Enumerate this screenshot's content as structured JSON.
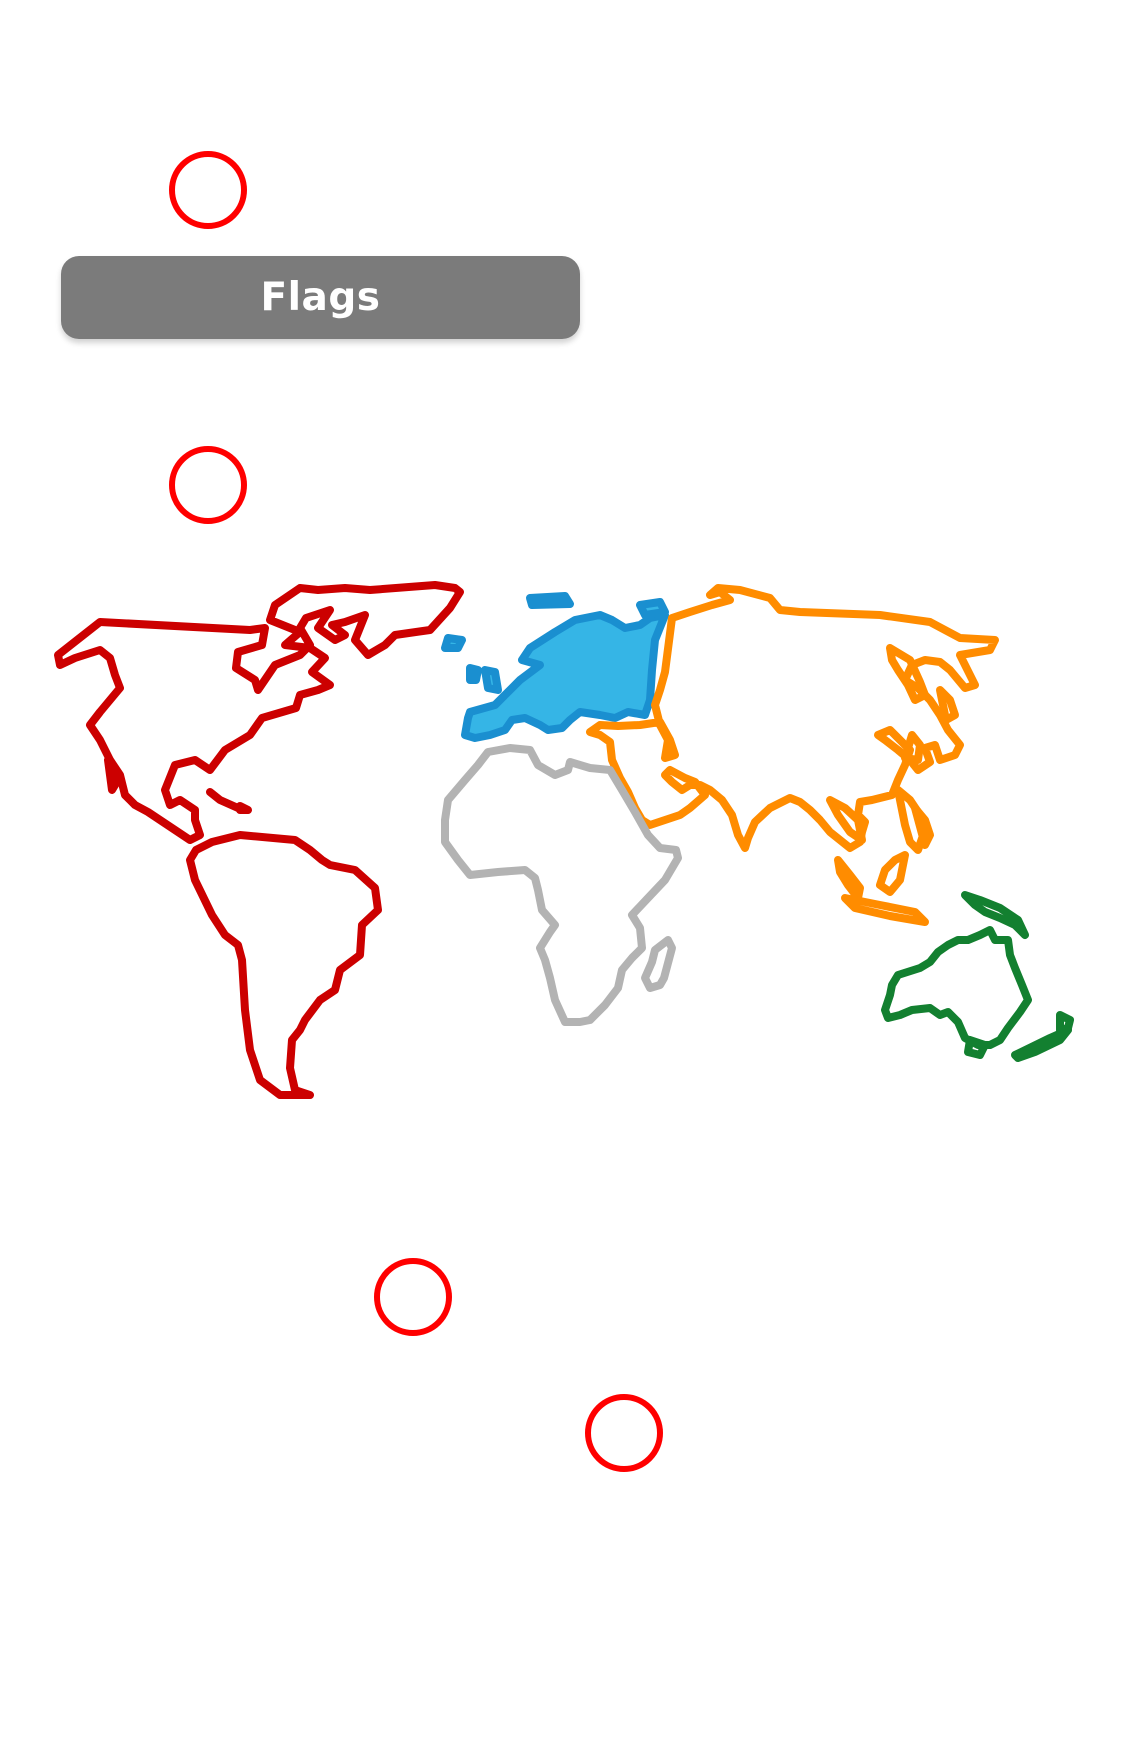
{
  "tooltip": {
    "label": "Flags"
  },
  "continents": [
    {
      "name": "north-south-america",
      "color": "#cc0000"
    },
    {
      "name": "europe",
      "color": "#1a8fd0",
      "fill": "#35b5e6"
    },
    {
      "name": "asia",
      "color": "#ff8c00"
    },
    {
      "name": "africa",
      "color": "#b3b3b3"
    },
    {
      "name": "oceania",
      "color": "#138030"
    }
  ],
  "markers": [
    {
      "name": "marker-1"
    },
    {
      "name": "marker-2"
    },
    {
      "name": "marker-3"
    },
    {
      "name": "marker-4"
    }
  ]
}
